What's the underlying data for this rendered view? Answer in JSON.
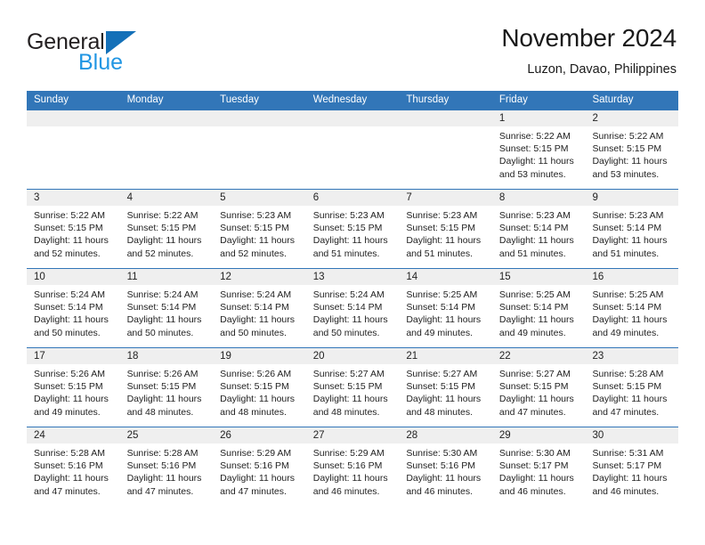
{
  "logo": {
    "word_one": "General",
    "word_two": "Blue",
    "triangle_icon": "blue-triangle-icon",
    "accent_dark": "#1470b8",
    "accent_light": "#2196e3"
  },
  "header": {
    "title": "November 2024",
    "subtitle": "Luzon, Davao, Philippines"
  },
  "theme": {
    "header_blue": "#3276b8",
    "daynum_gray": "#efefef"
  },
  "calendar": {
    "weekday_headers": [
      "Sunday",
      "Monday",
      "Tuesday",
      "Wednesday",
      "Thursday",
      "Friday",
      "Saturday"
    ],
    "weeks": [
      [
        {
          "day": "",
          "empty": true
        },
        {
          "day": "",
          "empty": true
        },
        {
          "day": "",
          "empty": true
        },
        {
          "day": "",
          "empty": true
        },
        {
          "day": "",
          "empty": true
        },
        {
          "day": "1",
          "sunrise": "Sunrise: 5:22 AM",
          "sunset": "Sunset: 5:15 PM",
          "daylight": "Daylight: 11 hours and 53 minutes."
        },
        {
          "day": "2",
          "sunrise": "Sunrise: 5:22 AM",
          "sunset": "Sunset: 5:15 PM",
          "daylight": "Daylight: 11 hours and 53 minutes."
        }
      ],
      [
        {
          "day": "3",
          "sunrise": "Sunrise: 5:22 AM",
          "sunset": "Sunset: 5:15 PM",
          "daylight": "Daylight: 11 hours and 52 minutes."
        },
        {
          "day": "4",
          "sunrise": "Sunrise: 5:22 AM",
          "sunset": "Sunset: 5:15 PM",
          "daylight": "Daylight: 11 hours and 52 minutes."
        },
        {
          "day": "5",
          "sunrise": "Sunrise: 5:23 AM",
          "sunset": "Sunset: 5:15 PM",
          "daylight": "Daylight: 11 hours and 52 minutes."
        },
        {
          "day": "6",
          "sunrise": "Sunrise: 5:23 AM",
          "sunset": "Sunset: 5:15 PM",
          "daylight": "Daylight: 11 hours and 51 minutes."
        },
        {
          "day": "7",
          "sunrise": "Sunrise: 5:23 AM",
          "sunset": "Sunset: 5:15 PM",
          "daylight": "Daylight: 11 hours and 51 minutes."
        },
        {
          "day": "8",
          "sunrise": "Sunrise: 5:23 AM",
          "sunset": "Sunset: 5:14 PM",
          "daylight": "Daylight: 11 hours and 51 minutes."
        },
        {
          "day": "9",
          "sunrise": "Sunrise: 5:23 AM",
          "sunset": "Sunset: 5:14 PM",
          "daylight": "Daylight: 11 hours and 51 minutes."
        }
      ],
      [
        {
          "day": "10",
          "sunrise": "Sunrise: 5:24 AM",
          "sunset": "Sunset: 5:14 PM",
          "daylight": "Daylight: 11 hours and 50 minutes."
        },
        {
          "day": "11",
          "sunrise": "Sunrise: 5:24 AM",
          "sunset": "Sunset: 5:14 PM",
          "daylight": "Daylight: 11 hours and 50 minutes."
        },
        {
          "day": "12",
          "sunrise": "Sunrise: 5:24 AM",
          "sunset": "Sunset: 5:14 PM",
          "daylight": "Daylight: 11 hours and 50 minutes."
        },
        {
          "day": "13",
          "sunrise": "Sunrise: 5:24 AM",
          "sunset": "Sunset: 5:14 PM",
          "daylight": "Daylight: 11 hours and 50 minutes."
        },
        {
          "day": "14",
          "sunrise": "Sunrise: 5:25 AM",
          "sunset": "Sunset: 5:14 PM",
          "daylight": "Daylight: 11 hours and 49 minutes."
        },
        {
          "day": "15",
          "sunrise": "Sunrise: 5:25 AM",
          "sunset": "Sunset: 5:14 PM",
          "daylight": "Daylight: 11 hours and 49 minutes."
        },
        {
          "day": "16",
          "sunrise": "Sunrise: 5:25 AM",
          "sunset": "Sunset: 5:14 PM",
          "daylight": "Daylight: 11 hours and 49 minutes."
        }
      ],
      [
        {
          "day": "17",
          "sunrise": "Sunrise: 5:26 AM",
          "sunset": "Sunset: 5:15 PM",
          "daylight": "Daylight: 11 hours and 49 minutes."
        },
        {
          "day": "18",
          "sunrise": "Sunrise: 5:26 AM",
          "sunset": "Sunset: 5:15 PM",
          "daylight": "Daylight: 11 hours and 48 minutes."
        },
        {
          "day": "19",
          "sunrise": "Sunrise: 5:26 AM",
          "sunset": "Sunset: 5:15 PM",
          "daylight": "Daylight: 11 hours and 48 minutes."
        },
        {
          "day": "20",
          "sunrise": "Sunrise: 5:27 AM",
          "sunset": "Sunset: 5:15 PM",
          "daylight": "Daylight: 11 hours and 48 minutes."
        },
        {
          "day": "21",
          "sunrise": "Sunrise: 5:27 AM",
          "sunset": "Sunset: 5:15 PM",
          "daylight": "Daylight: 11 hours and 48 minutes."
        },
        {
          "day": "22",
          "sunrise": "Sunrise: 5:27 AM",
          "sunset": "Sunset: 5:15 PM",
          "daylight": "Daylight: 11 hours and 47 minutes."
        },
        {
          "day": "23",
          "sunrise": "Sunrise: 5:28 AM",
          "sunset": "Sunset: 5:15 PM",
          "daylight": "Daylight: 11 hours and 47 minutes."
        }
      ],
      [
        {
          "day": "24",
          "sunrise": "Sunrise: 5:28 AM",
          "sunset": "Sunset: 5:16 PM",
          "daylight": "Daylight: 11 hours and 47 minutes."
        },
        {
          "day": "25",
          "sunrise": "Sunrise: 5:28 AM",
          "sunset": "Sunset: 5:16 PM",
          "daylight": "Daylight: 11 hours and 47 minutes."
        },
        {
          "day": "26",
          "sunrise": "Sunrise: 5:29 AM",
          "sunset": "Sunset: 5:16 PM",
          "daylight": "Daylight: 11 hours and 47 minutes."
        },
        {
          "day": "27",
          "sunrise": "Sunrise: 5:29 AM",
          "sunset": "Sunset: 5:16 PM",
          "daylight": "Daylight: 11 hours and 46 minutes."
        },
        {
          "day": "28",
          "sunrise": "Sunrise: 5:30 AM",
          "sunset": "Sunset: 5:16 PM",
          "daylight": "Daylight: 11 hours and 46 minutes."
        },
        {
          "day": "29",
          "sunrise": "Sunrise: 5:30 AM",
          "sunset": "Sunset: 5:17 PM",
          "daylight": "Daylight: 11 hours and 46 minutes."
        },
        {
          "day": "30",
          "sunrise": "Sunrise: 5:31 AM",
          "sunset": "Sunset: 5:17 PM",
          "daylight": "Daylight: 11 hours and 46 minutes."
        }
      ]
    ]
  }
}
